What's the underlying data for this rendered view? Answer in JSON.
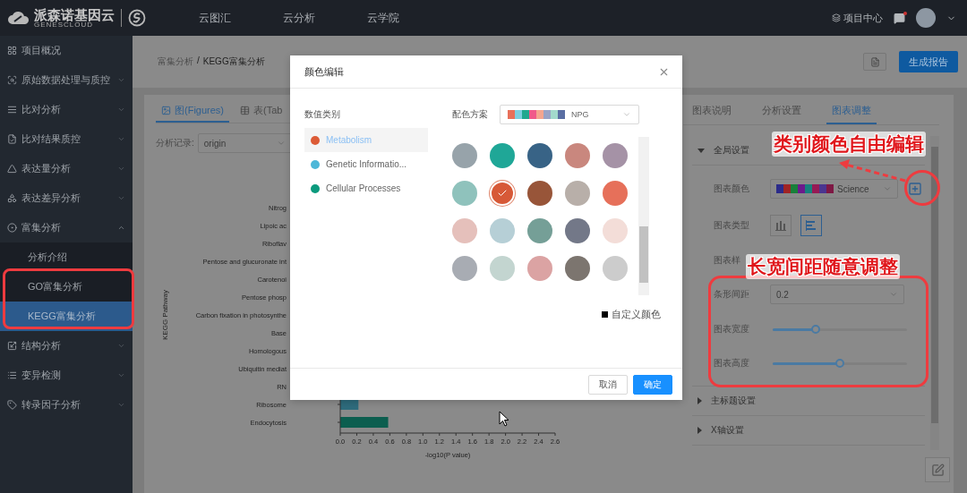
{
  "top_bar": {
    "logo_text": "派森诺基因云",
    "logo_subtext": "GENESCLOUD",
    "nav": [
      "云图汇",
      "云分析",
      "云学院"
    ],
    "project_center": "项目中心"
  },
  "sidebar": {
    "items": [
      {
        "label": "项目概况"
      },
      {
        "label": "原始数据处理与质控",
        "expanded": false
      },
      {
        "label": "比对分析",
        "expanded": false
      },
      {
        "label": "比对结果质控",
        "expanded": false
      },
      {
        "label": "表达量分析",
        "expanded": false
      },
      {
        "label": "表达差异分析",
        "expanded": false
      },
      {
        "label": "富集分析",
        "expanded": true,
        "children": [
          {
            "label": "分析介绍",
            "selected": false
          },
          {
            "label": "GO富集分析",
            "selected": false
          },
          {
            "label": "KEGG富集分析",
            "selected": true
          }
        ]
      },
      {
        "label": "结构分析",
        "expanded": false
      },
      {
        "label": "变异检测",
        "expanded": false
      },
      {
        "label": "转录因子分析",
        "expanded": false
      }
    ]
  },
  "breadcrumb": {
    "items": [
      "富集分析",
      "KEGG富集分析"
    ],
    "separator": "/"
  },
  "report_button": "生成报告",
  "figures_panel": {
    "tabs": [
      {
        "label": "图(Figures)",
        "selected": true
      },
      {
        "label": "表(Tab",
        "selected": false
      }
    ],
    "record": {
      "label": "分析记录:",
      "value": "origin"
    },
    "chart_data": {
      "type": "bar",
      "orientation": "horizontal",
      "xlabel": "-log10(P value)",
      "ylabel": "KEGG Pathway",
      "categories": [
        "Nitrog",
        "Lipoic ac",
        "Riboflav",
        "Pentose and glucuronate int",
        "Carotenoi",
        "Pentose phosp",
        "Carbon fixation in photosynthe",
        "Base",
        "Homologous",
        "Ubiquitin mediat",
        "RN",
        "Ribosome",
        "Endocytosis"
      ],
      "series": [
        {
          "color": "#2e6b7c",
          "values": [
            null,
            null,
            null,
            null,
            null,
            null,
            null,
            null,
            null,
            null,
            null,
            0.22,
            null
          ]
        },
        {
          "color": "#0c5e4f",
          "values": [
            null,
            null,
            null,
            null,
            null,
            null,
            null,
            null,
            null,
            null,
            null,
            null,
            0.58
          ]
        }
      ],
      "xlim": [
        0,
        2.6
      ],
      "xticks": [
        {
          "value": 0,
          "label": "0.0"
        },
        {
          "value": 0.2,
          "label": "0.2"
        },
        {
          "value": 0.4,
          "label": "0.4"
        },
        {
          "value": 0.6,
          "label": "0.6"
        },
        {
          "value": 0.8,
          "label": "0.8"
        },
        {
          "value": 1.0,
          "label": "1.0"
        },
        {
          "value": 1.2,
          "label": "1.2"
        },
        {
          "value": 1.4,
          "label": "1.4"
        },
        {
          "value": 1.6,
          "label": "1.6"
        },
        {
          "value": 1.8,
          "label": "1.8"
        },
        {
          "value": 2.0,
          "label": "2.0"
        },
        {
          "value": 2.2,
          "label": "2.2"
        },
        {
          "value": 2.4,
          "label": "2.4"
        },
        {
          "value": 2.6,
          "label": "2.6"
        }
      ]
    }
  },
  "settings_panel": {
    "tabs": [
      {
        "label": "图表说明",
        "selected": false
      },
      {
        "label": "分析设置",
        "selected": false
      },
      {
        "label": "图表调整",
        "selected": true
      }
    ],
    "sections": [
      {
        "title": "全局设置",
        "expanded": true,
        "rows": [
          {
            "kind": "palette",
            "label": "图表颜色",
            "value": "Science"
          },
          {
            "kind": "chart_type",
            "label": "图表类型",
            "options": [
              {
                "kind": "column",
                "selected": false
              },
              {
                "kind": "bar",
                "selected": true
              }
            ]
          },
          {
            "kind": "text",
            "label": "图表样"
          },
          {
            "kind": "select",
            "label": "条形间距",
            "value": "0.2"
          },
          {
            "kind": "slider",
            "label": "图表宽度",
            "level": 0.32
          },
          {
            "kind": "slider",
            "label": "图表高度",
            "level": 0.5
          }
        ]
      },
      {
        "title": "主标题设置",
        "expanded": false
      },
      {
        "title": "X轴设置",
        "expanded": false
      }
    ]
  },
  "color_dialog": {
    "title": "颜色编辑",
    "category_heading": "数值类别",
    "categories": [
      {
        "label": "Metabolism",
        "color": "#dc5b36",
        "selected": true
      },
      {
        "label": "Genetic Informatio...",
        "color": "#4db7d8",
        "selected": false
      },
      {
        "label": "Cellular Processes",
        "color": "#0b9a7d",
        "selected": false
      }
    ],
    "scheme_label": "配色方案",
    "scheme": {
      "value": "NPG"
    },
    "colors": [
      {
        "color": "#97a3aa",
        "selected": false
      },
      {
        "color": "#1fa797",
        "selected": false
      },
      {
        "color": "#386386",
        "selected": false
      },
      {
        "color": "#c9877e",
        "selected": false
      },
      {
        "color": "#a592a6",
        "selected": false
      },
      {
        "color": "#8fc2bc",
        "selected": false
      },
      {
        "color": "#d75937",
        "selected": true
      },
      {
        "color": "#985539",
        "selected": false
      },
      {
        "color": "#b8afa9",
        "selected": false
      },
      {
        "color": "#e6705a",
        "selected": false
      },
      {
        "color": "#e5c0bb",
        "selected": false
      },
      {
        "color": "#b6cfd6",
        "selected": false
      },
      {
        "color": "#759f97",
        "selected": false
      },
      {
        "color": "#737888",
        "selected": false
      },
      {
        "color": "#f3ddd8",
        "selected": false
      },
      {
        "color": "#a8acb3",
        "selected": false
      },
      {
        "color": "#c3d5d0",
        "selected": false
      },
      {
        "color": "#dba3a3",
        "selected": false
      },
      {
        "color": "#7c756f",
        "selected": false
      },
      {
        "color": "#cccccc",
        "selected": false
      }
    ],
    "custom_label": "自定义颜色",
    "buttons": [
      {
        "label": "取消",
        "kind": "secondary"
      },
      {
        "label": "确定",
        "kind": "primary"
      }
    ]
  },
  "annotations": [
    {
      "text": "类别颜色自由编辑"
    },
    {
      "text": "长宽间距随意调整"
    }
  ]
}
